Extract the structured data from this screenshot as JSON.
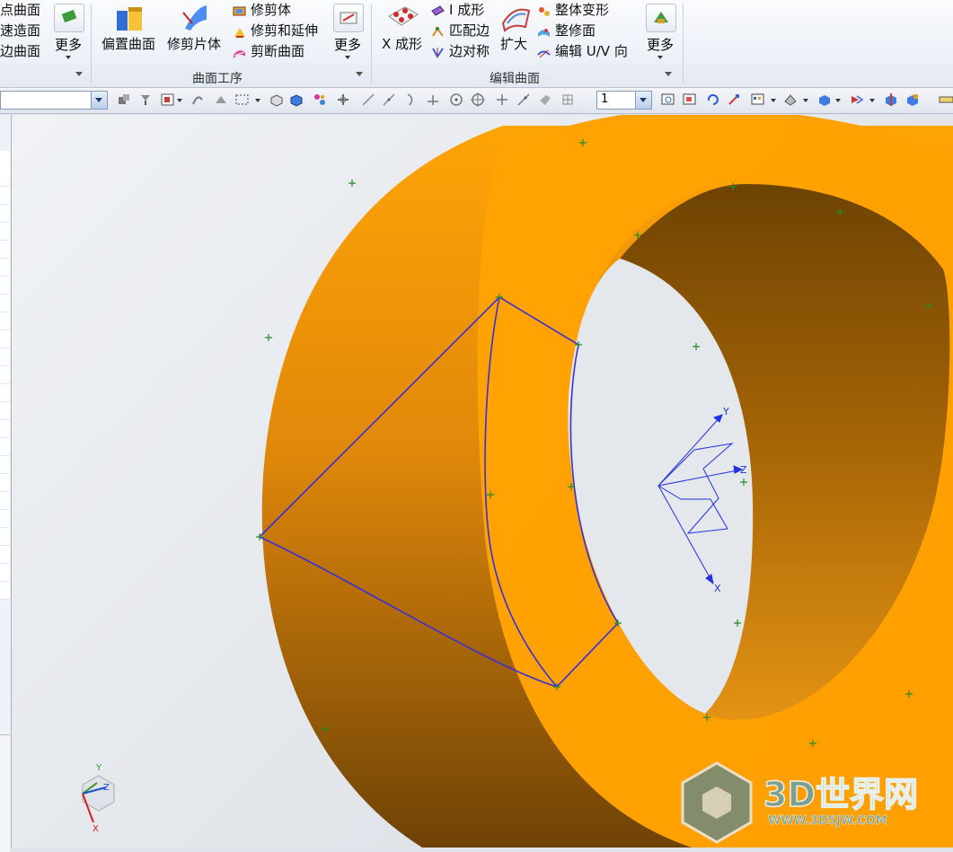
{
  "ribbon": {
    "left_partial_items": [
      "点曲面",
      "速造面",
      "边曲面"
    ],
    "more_label": "更多",
    "group_trim": {
      "label": "曲面工序",
      "offset_surface": "偏置曲面",
      "trim_sheet": "修剪片体",
      "trimmed_body": "修剪体",
      "trim_extend": "修剪和延伸",
      "divide_face": "剪断曲面",
      "more": "更多"
    },
    "group_edit": {
      "label": "编辑曲面",
      "x_form": "X 成形",
      "i_form": "I 成形",
      "match_edge": "匹配边",
      "edge_symmetry": "边对称",
      "enlarge": "扩大",
      "global_shaping": "整体变形",
      "face_repair": "整修面",
      "edit_uv": "编辑 U/V 向",
      "more": "更多"
    }
  },
  "toolbar": {
    "selection_filter_value": "",
    "layer_value": "1"
  },
  "viewport": {
    "wcs_labels": {
      "x": "X",
      "y": "Y",
      "z": "Z"
    },
    "triad_labels": {
      "x": "X",
      "y": "Y",
      "z": "Z"
    },
    "watermark_title": "3D世界网",
    "watermark_url": "WWW.3DSJW.COM",
    "colors": {
      "surface_light": "#ffa500",
      "surface_dark": "#7a4a00",
      "edges": "#3a2fd6",
      "markers": "#2a8a2a"
    }
  }
}
